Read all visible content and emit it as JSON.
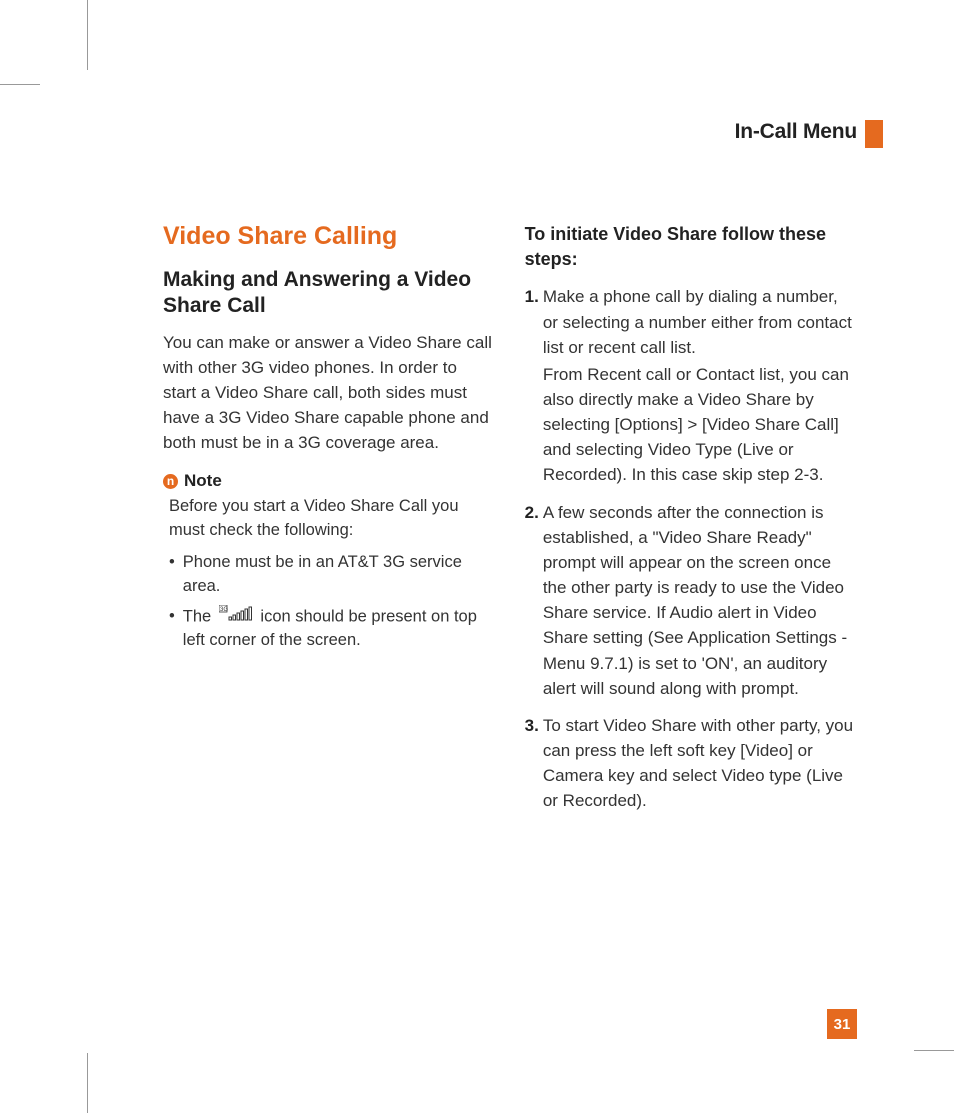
{
  "header": {
    "section": "In-Call Menu"
  },
  "left": {
    "topic": "Video Share Calling",
    "subtitle": "Making and Answering a Video Share Call",
    "body": "You can make or answer a Video Share call with other 3G video phones. In order to start a Video Share call, both sides must have a 3G Video Share capable phone and both must be in a 3G coverage area.",
    "note": {
      "title": "Note",
      "body": "Before you start a Video Share Call you must check the following:",
      "bullets": [
        "Phone must be in an AT&T 3G service area.",
        {
          "pre": "The ",
          "post": " icon should be present on top left corner of the screen."
        }
      ]
    }
  },
  "right": {
    "heading": "To initiate Video Share follow these steps:",
    "steps": [
      {
        "num": "1.",
        "text": "Make a phone call by dialing a number, or selecting a number either from contact list or recent call list.",
        "sub": "From Recent call or Contact list, you can also directly make a Video Share by selecting [Options] > [Video Share Call] and selecting Video Type (Live or Recorded). In this case skip step 2-3."
      },
      {
        "num": "2.",
        "text": "A few seconds after the connection is established, a \"Video Share Ready\" prompt will appear on the screen once the other party is ready to use the Video Share service. If Audio alert in Video Share setting (See Application Settings - Menu 9.7.1) is set to 'ON', an auditory alert will sound along with prompt."
      },
      {
        "num": "3.",
        "text": "To start Video Share with other party, you can press the left soft key [Video] or Camera key and select Video type (Live or Recorded)."
      }
    ]
  },
  "page_number": "31"
}
